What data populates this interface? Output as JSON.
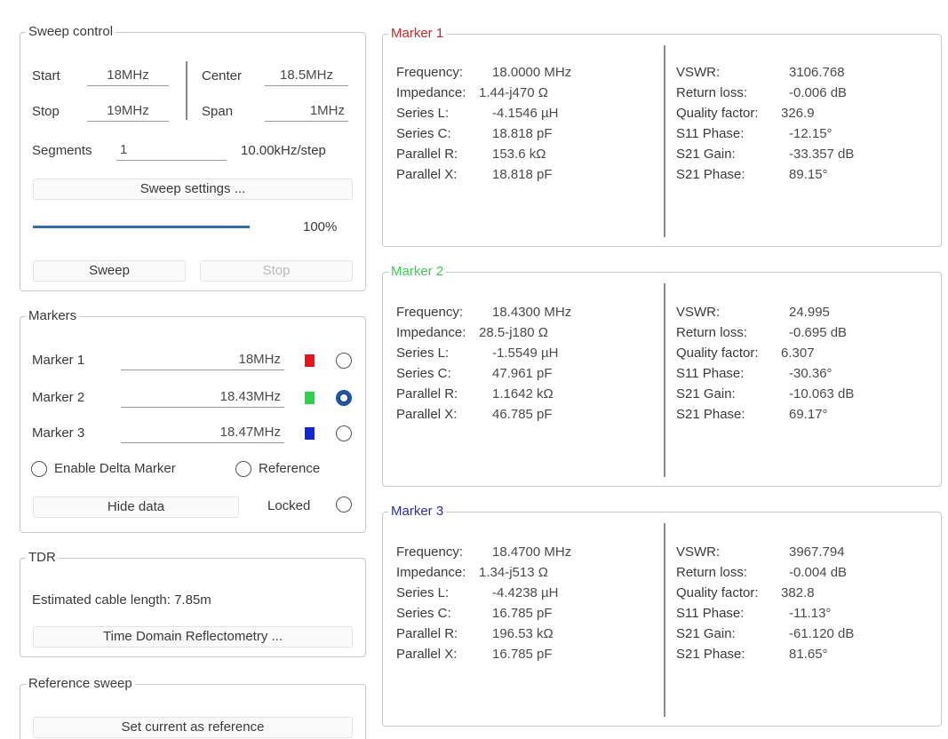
{
  "sweep_control": {
    "title": "Sweep control",
    "start_label": "Start",
    "start_value": "18MHz",
    "stop_label": "Stop",
    "stop_value": "19MHz",
    "center_label": "Center",
    "center_value": "18.5MHz",
    "span_label": "Span",
    "span_value": "1MHz",
    "segments_label": "Segments",
    "segments_value": "1",
    "step_text": "10.00kHz/step",
    "settings_button": "Sweep settings ...",
    "progress_text": "100%",
    "progress_fraction": 1.0,
    "sweep_button": "Sweep",
    "stop_button": "Stop"
  },
  "markers": {
    "title": "Markers",
    "items": [
      {
        "label": "Marker 1",
        "value": "18MHz",
        "color": "#e8141b",
        "selected": false
      },
      {
        "label": "Marker 2",
        "value": "18.43MHz",
        "color": "#2ed34a",
        "selected": true
      },
      {
        "label": "Marker 3",
        "value": "18.47MHz",
        "color": "#1424d8",
        "selected": false
      }
    ],
    "delta_label": "Enable Delta Marker",
    "reference_label": "Reference",
    "hide_button": "Hide data",
    "locked_label": "Locked"
  },
  "tdr": {
    "title": "TDR",
    "cable_length_text": "Estimated cable length: 7.85m",
    "button": "Time Domain Reflectometry ..."
  },
  "reference_sweep": {
    "title": "Reference sweep",
    "button": "Set current as reference"
  },
  "marker_panels": [
    {
      "title": "Marker 1",
      "title_color": "#c0282d",
      "left_labels": [
        "Frequency:",
        "Impedance:",
        "Series L:",
        "Series C:",
        "Parallel R:",
        "Parallel X:"
      ],
      "left_values": [
        "18.0000 MHz",
        "1.44-j470 Ω",
        "-4.1546 µH",
        "18.818 pF",
        "153.6 kΩ",
        "18.818 pF"
      ],
      "right_labels": [
        "VSWR:",
        "Return loss:",
        "Quality factor:",
        "S11 Phase:",
        "S21 Gain:",
        "S21 Phase:"
      ],
      "right_values": [
        "3106.768",
        "-0.006 dB",
        "326.9",
        "-12.15°",
        "-33.357 dB",
        "89.15°"
      ]
    },
    {
      "title": "Marker 2",
      "title_color": "#3fc85a",
      "left_labels": [
        "Frequency:",
        "Impedance:",
        "Series L:",
        "Series C:",
        "Parallel R:",
        "Parallel X:"
      ],
      "left_values": [
        "18.4300 MHz",
        "28.5-j180 Ω",
        "-1.5549 µH",
        "47.961 pF",
        "1.1642 kΩ",
        "46.785 pF"
      ],
      "right_labels": [
        "VSWR:",
        "Return loss:",
        "Quality factor:",
        "S11 Phase:",
        "S21 Gain:",
        "S21 Phase:"
      ],
      "right_values": [
        "24.995",
        "-0.695 dB",
        "6.307",
        "-30.36°",
        "-10.063 dB",
        "69.17°"
      ]
    },
    {
      "title": "Marker 3",
      "title_color": "#2a2fa0",
      "left_labels": [
        "Frequency:",
        "Impedance:",
        "Series L:",
        "Series C:",
        "Parallel R:",
        "Parallel X:"
      ],
      "left_values": [
        "18.4700 MHz",
        "1.34-j513 Ω",
        "-4.4238 µH",
        "16.785 pF",
        "196.53 kΩ",
        "16.785 pF"
      ],
      "right_labels": [
        "VSWR:",
        "Return loss:",
        "Quality factor:",
        "S11 Phase:",
        "S21 Gain:",
        "S21 Phase:"
      ],
      "right_values": [
        "3967.794",
        "-0.004 dB",
        "382.8",
        "-11.13°",
        "-61.120 dB",
        "81.65°"
      ]
    }
  ]
}
